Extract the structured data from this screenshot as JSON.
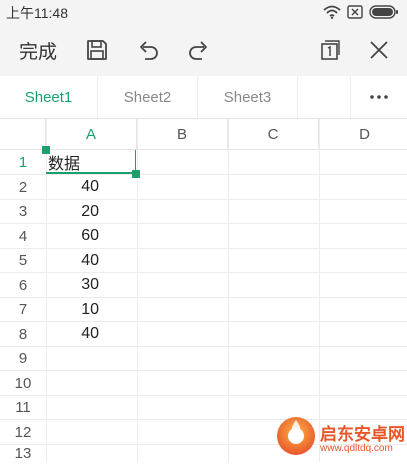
{
  "status": {
    "time": "上午11:48"
  },
  "toolbar": {
    "done_label": "完成"
  },
  "tabs": [
    {
      "label": "Sheet1",
      "active": true
    },
    {
      "label": "Sheet2",
      "active": false
    },
    {
      "label": "Sheet3",
      "active": false
    }
  ],
  "columns": [
    "A",
    "B",
    "C",
    "D"
  ],
  "rows": [
    "1",
    "2",
    "3",
    "4",
    "5",
    "6",
    "7",
    "8",
    "9",
    "10",
    "11",
    "12",
    "13"
  ],
  "cells": {
    "A1": "数据",
    "A2": "40",
    "A3": "20",
    "A4": "60",
    "A5": "40",
    "A6": "30",
    "A7": "10",
    "A8": "40"
  },
  "accent_color": "#1aa06d",
  "watermark": {
    "brand": "启东安卓网",
    "url": "www.qdltdq.com"
  }
}
